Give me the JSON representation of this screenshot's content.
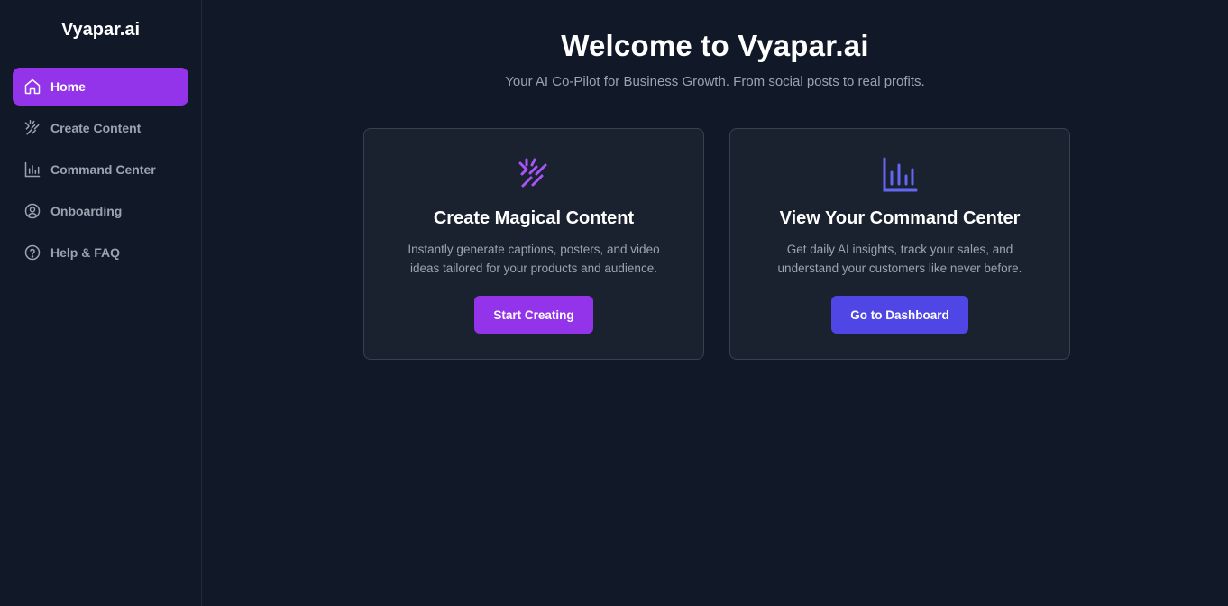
{
  "sidebar": {
    "brand": "Vyapar.ai",
    "items": [
      {
        "label": "Home",
        "icon": "home-icon",
        "active": true
      },
      {
        "label": "Create Content",
        "icon": "sparkles-wand-icon",
        "active": false
      },
      {
        "label": "Command Center",
        "icon": "bar-chart-icon",
        "active": false
      },
      {
        "label": "Onboarding",
        "icon": "user-circle-icon",
        "active": false
      },
      {
        "label": "Help & FAQ",
        "icon": "help-circle-icon",
        "active": false
      }
    ]
  },
  "hero": {
    "title": "Welcome to Vyapar.ai",
    "subtitle": "Your AI Co-Pilot for Business Growth. From social posts to real profits."
  },
  "cards": [
    {
      "icon": "sparkles-wand-icon",
      "title": "Create Magical Content",
      "description": "Instantly generate captions, posters, and video ideas tailored for your products and audience.",
      "button": "Start Creating"
    },
    {
      "icon": "bar-chart-icon",
      "title": "View Your Command Center",
      "description": "Get daily AI insights, track your sales, and understand your customers like never before.",
      "button": "Go to Dashboard"
    }
  ],
  "colors": {
    "background": "#111827",
    "card": "#1a2230",
    "accent_purple": "#9333ea",
    "accent_indigo": "#4f46e5",
    "icon_purple": "#a855f7",
    "icon_indigo": "#6366f1"
  }
}
